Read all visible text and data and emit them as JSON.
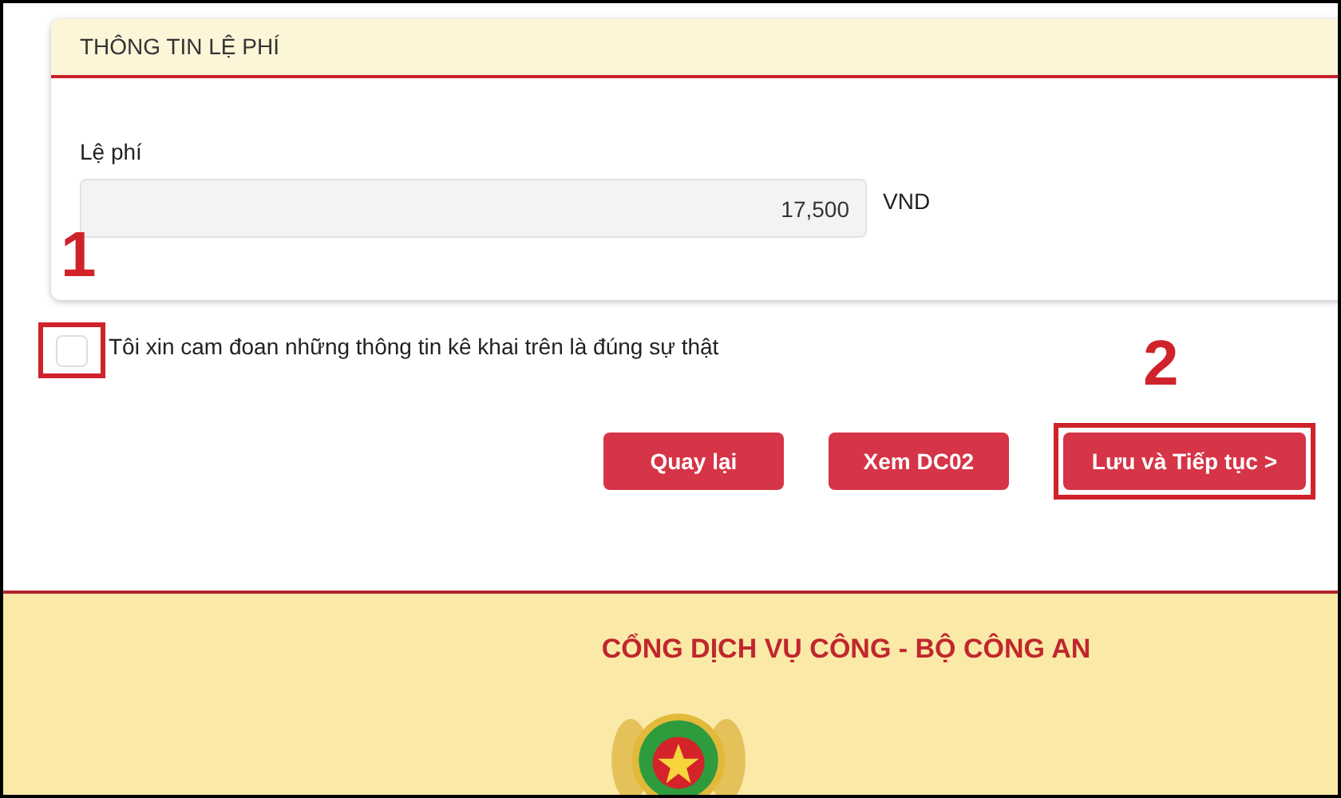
{
  "fee_section": {
    "title": "THÔNG TIN LỆ PHÍ",
    "field_label": "Lệ phí",
    "value": "17,500",
    "unit": "VND"
  },
  "declaration": {
    "label": "Tôi xin cam đoan những thông tin kê khai trên là đúng sự thật",
    "checked": false
  },
  "buttons": [
    {
      "label": "Quay lại",
      "highlighted": false
    },
    {
      "label": "Xem DC02",
      "highlighted": false
    },
    {
      "label": "Lưu và Tiếp tục >",
      "highlighted": true
    }
  ],
  "annotations": [
    {
      "label": "1"
    },
    {
      "label": "2"
    }
  ],
  "footer": {
    "title": "CỔNG DỊCH VỤ CÔNG - BỘ CÔNG AN"
  }
}
